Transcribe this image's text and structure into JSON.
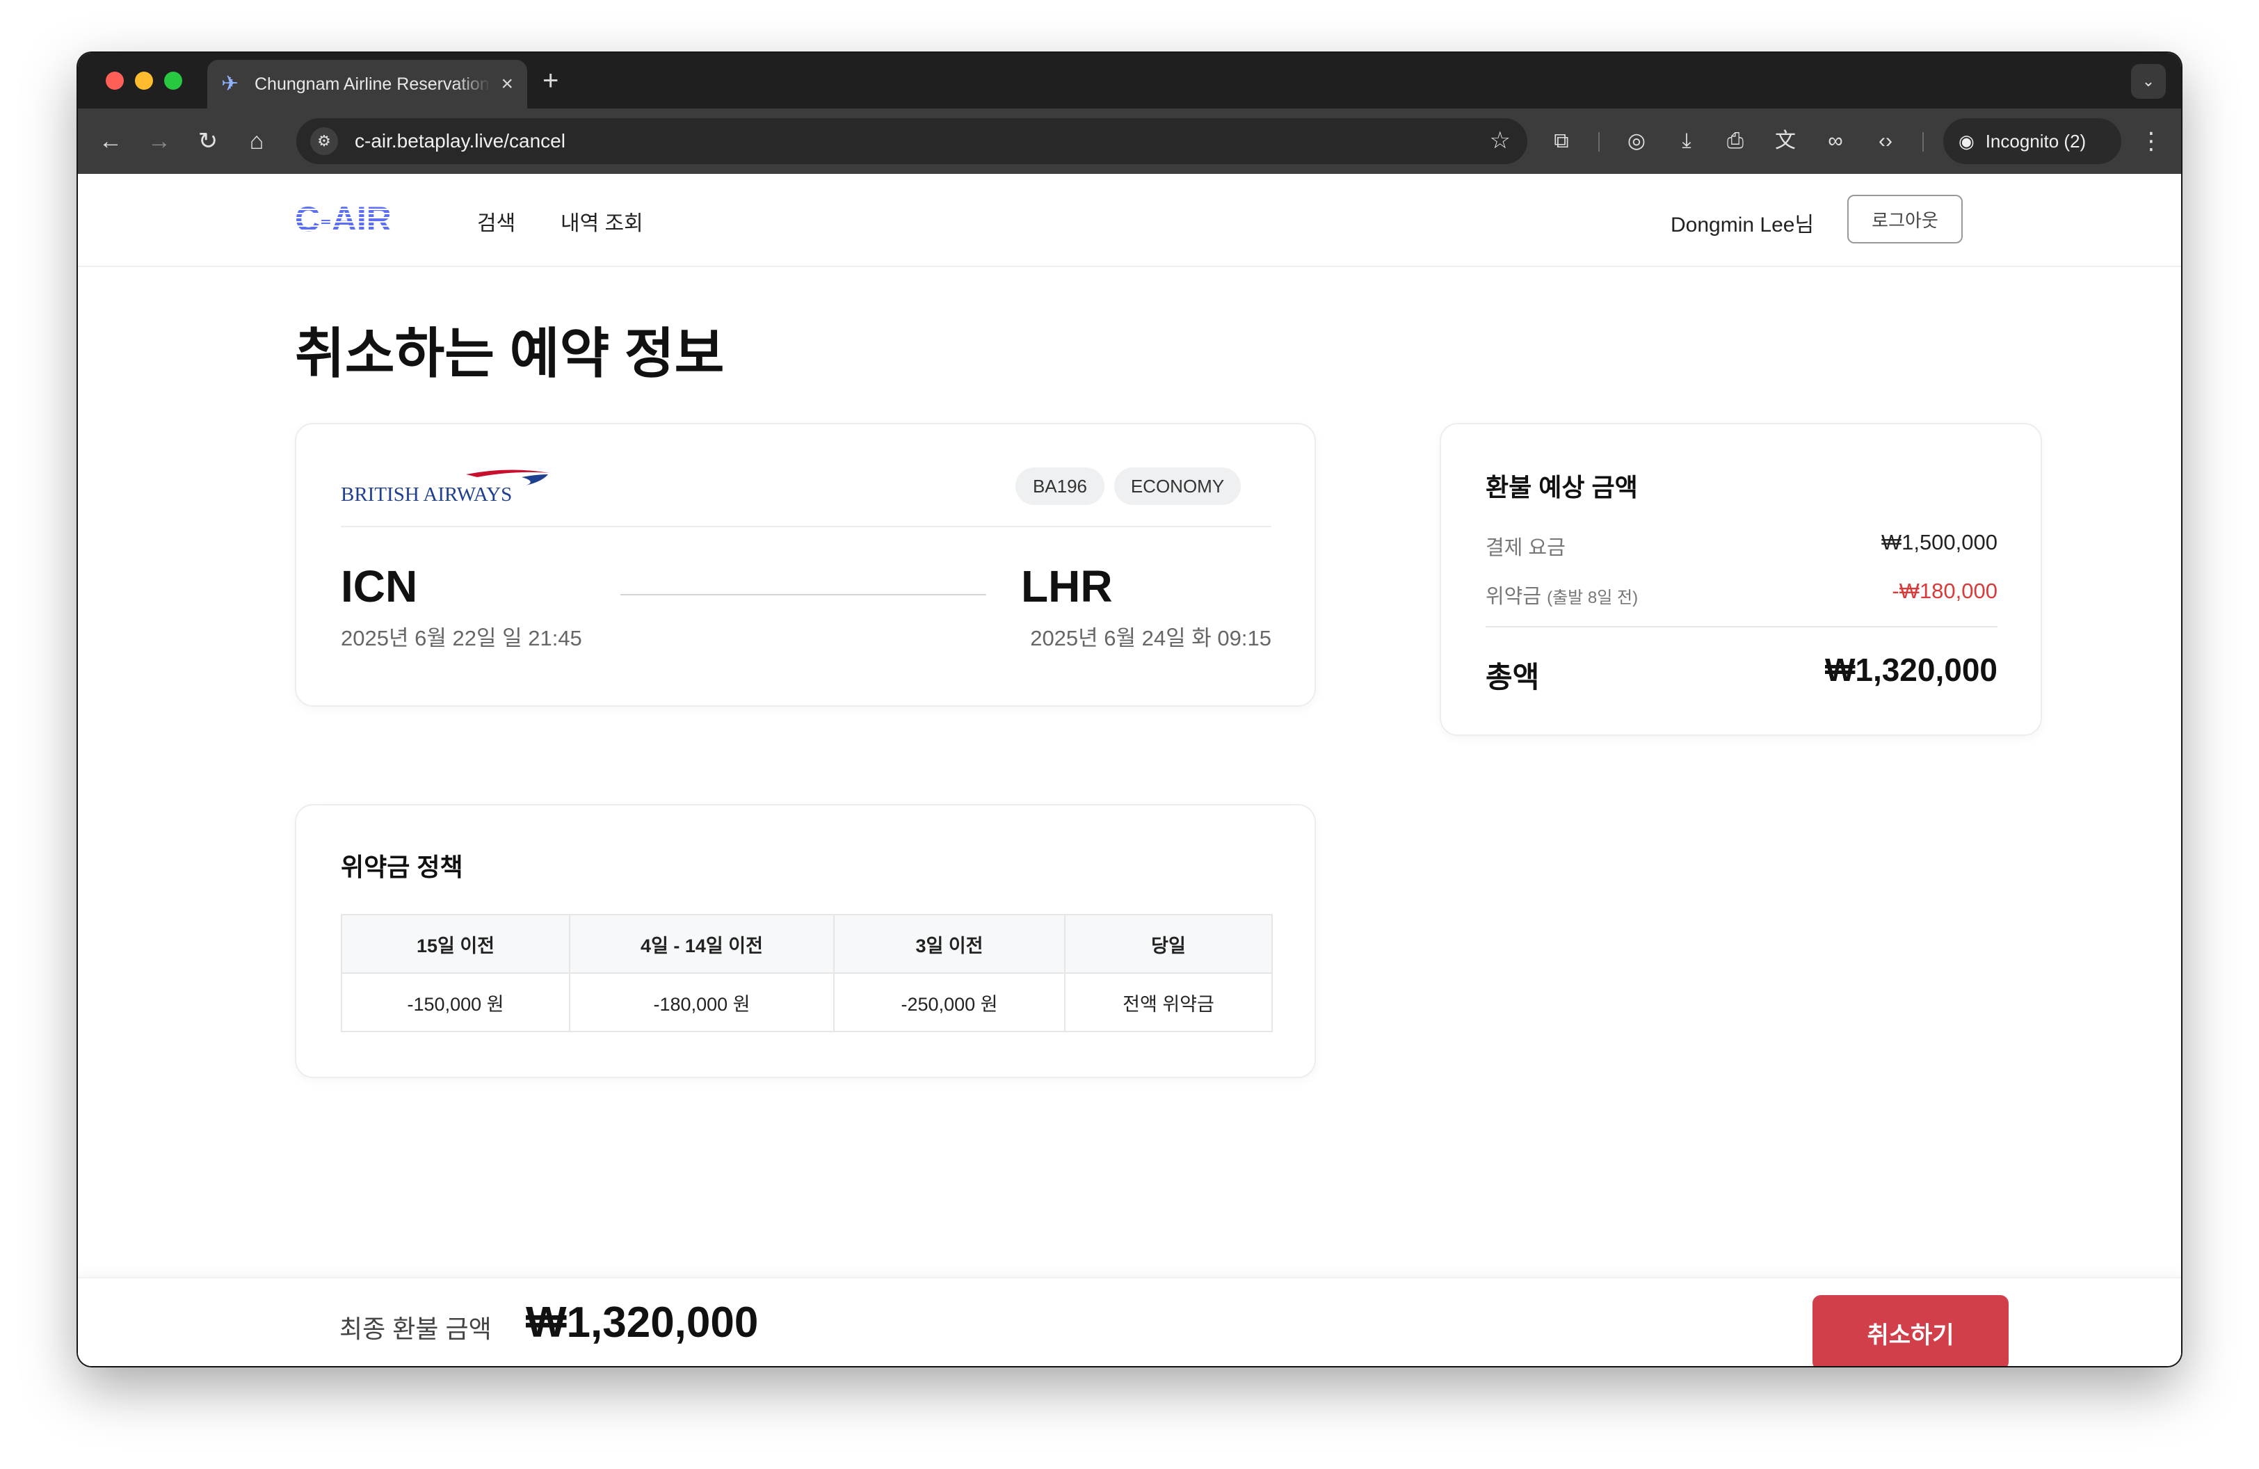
{
  "browser": {
    "tab_title": "Chungnam Airline Reservation",
    "tab_icon": "airplane-icon",
    "url": "c-air.betaplay.live/cancel",
    "incognito_label": "Incognito (2)"
  },
  "header": {
    "logo_text": "C-AIR",
    "nav": [
      "검색",
      "내역 조회"
    ],
    "user_name": "Dongmin Lee님",
    "logout_label": "로그아웃"
  },
  "page_title": "취소하는 예약 정보",
  "flight": {
    "airline": "BRITISH AIRWAYS",
    "flight_no": "BA196",
    "cabin": "ECONOMY",
    "origin": {
      "code": "ICN",
      "time": "2025년 6월 22일 일 21:45"
    },
    "destination": {
      "code": "LHR",
      "time": "2025년 6월 24일 화 09:15"
    }
  },
  "policy": {
    "title": "위약금 정책",
    "headers": [
      "15일 이전",
      "4일 - 14일 이전",
      "3일 이전",
      "당일"
    ],
    "values": [
      "-150,000 원",
      "-180,000 원",
      "-250,000 원",
      "전액 위약금"
    ]
  },
  "refund": {
    "title": "환불 예상 금액",
    "fare_label": "결제 요금",
    "fare_value": "₩1,500,000",
    "penalty_label": "위약금",
    "penalty_note": "(출발 8일 전)",
    "penalty_value": "-₩180,000",
    "total_label": "총액",
    "total_value": "₩1,320,000"
  },
  "footer": {
    "final_label": "최종 환불 금액",
    "final_amount": "₩1,320,000",
    "cancel_label": "취소하기"
  },
  "colors": {
    "accent_blue": "#5b6ff0",
    "penalty_red": "#d93a3a",
    "cancel_button": "#d1404a",
    "ba_navy": "#1f3f8f",
    "ba_red": "#c8102e"
  }
}
